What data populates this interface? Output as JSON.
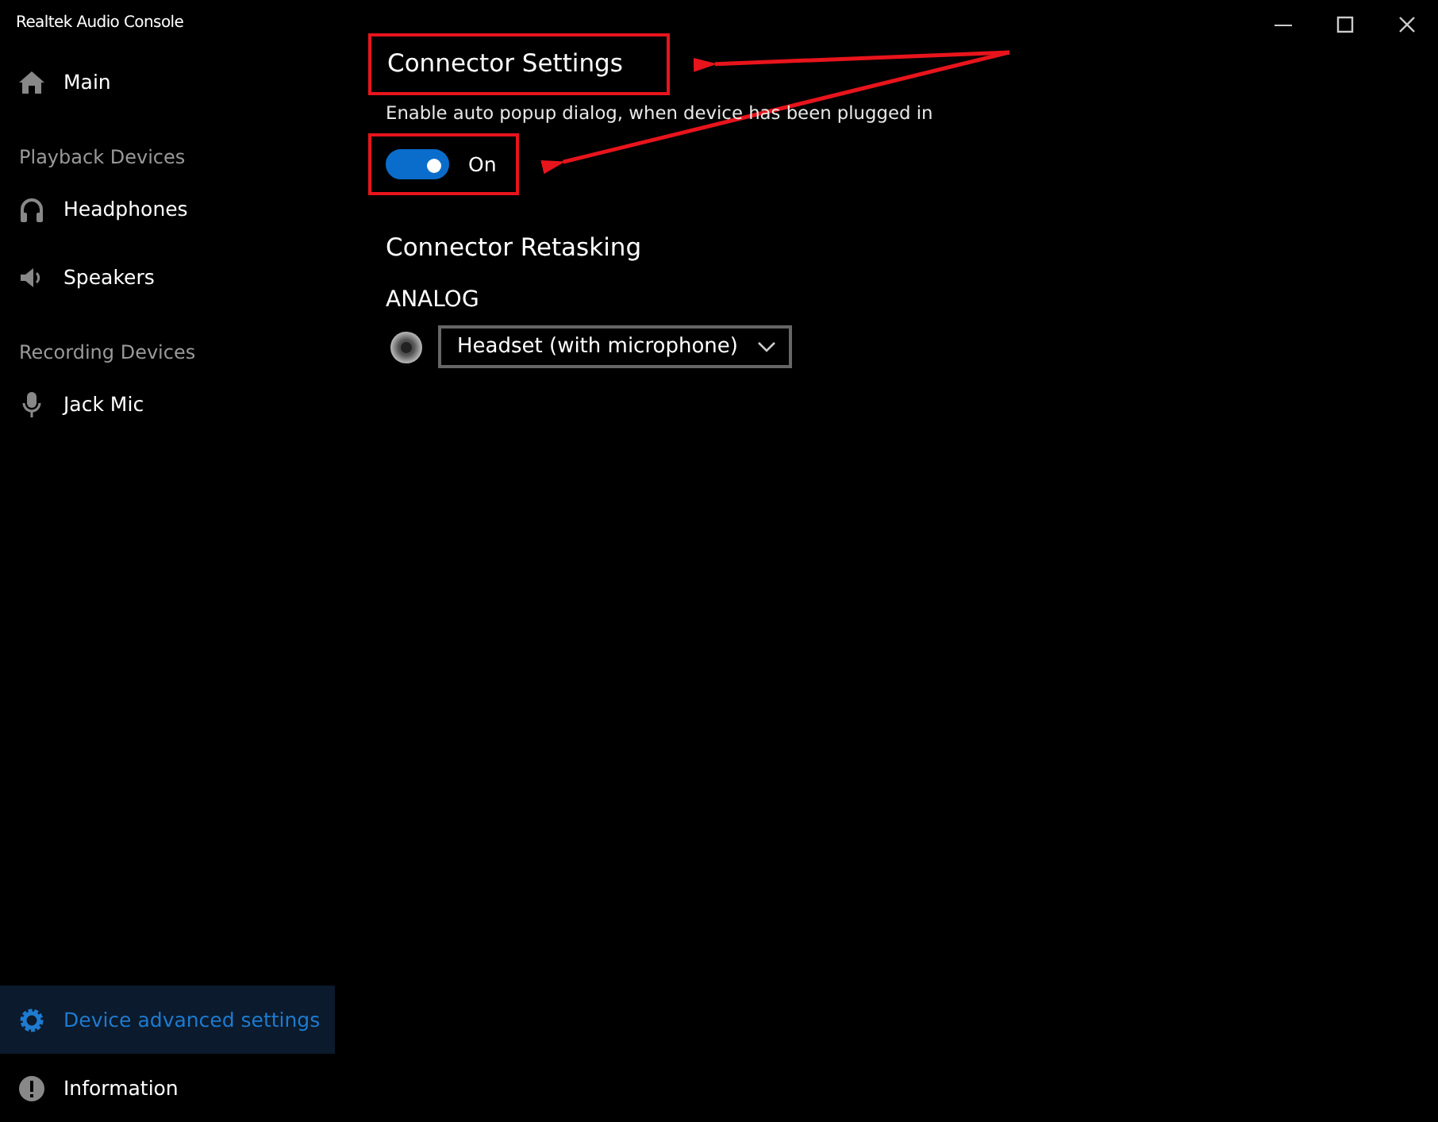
{
  "window": {
    "title": "Realtek Audio Console"
  },
  "sidebar": {
    "sections": [
      {
        "items": [
          {
            "label": "Main",
            "kind": "home",
            "selected": false
          }
        ]
      },
      {
        "header": "Playback Devices",
        "items": [
          {
            "label": "Headphones",
            "kind": "headphones",
            "selected": false
          },
          {
            "label": "Speakers",
            "kind": "speaker",
            "selected": false
          }
        ]
      },
      {
        "header": "Recording Devices",
        "items": [
          {
            "label": "Jack Mic",
            "kind": "mic",
            "selected": false
          }
        ]
      }
    ],
    "bottom_items": [
      {
        "label": "Device advanced settings",
        "kind": "settings",
        "selected": true
      },
      {
        "label": "Information",
        "kind": "info",
        "selected": false
      }
    ]
  },
  "connector_settings": {
    "heading": "Connector Settings",
    "highlighted": true,
    "description": "Enable auto popup dialog, when device has been plugged in",
    "toggle": {
      "on": true,
      "label": "On",
      "highlighted": true
    }
  },
  "connector_retasking": {
    "heading": "Connector Retasking",
    "group": "ANALOG",
    "dropdown": {
      "value": "Headset (with microphone)"
    }
  }
}
